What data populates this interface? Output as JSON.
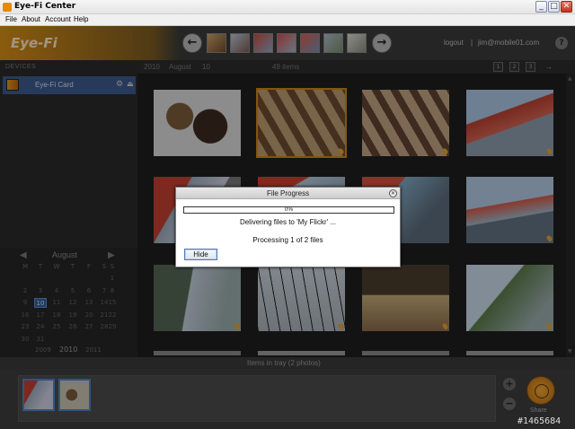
{
  "window": {
    "title": "Eye-Fi Center",
    "controls": {
      "minimize": "_",
      "maximize": "□",
      "close": "✕"
    }
  },
  "menu": [
    "File",
    "About",
    "Account",
    "Help"
  ],
  "header": {
    "logo": "Eye-Fi",
    "logout": "logout",
    "separator": "|",
    "user_email": "jim@mobile01.com",
    "help": "?"
  },
  "sidebar": {
    "devices_heading": "DEVICES",
    "device_label": "Eye-Fi Card"
  },
  "calendar": {
    "month": "August",
    "weekdays": [
      "M",
      "T",
      "W",
      "T",
      "F",
      "S",
      "S"
    ],
    "weeks": [
      [
        "",
        "",
        "",
        "",
        "",
        "",
        "1"
      ],
      [
        "2",
        "3",
        "4",
        "5",
        "6",
        "7",
        "8"
      ],
      [
        "9",
        "10",
        "11",
        "12",
        "13",
        "14",
        "15"
      ],
      [
        "16",
        "17",
        "18",
        "19",
        "20",
        "21",
        "22"
      ],
      [
        "23",
        "24",
        "25",
        "26",
        "27",
        "28",
        "29"
      ],
      [
        "30",
        "31",
        "",
        "",
        "",
        "",
        ""
      ]
    ],
    "selected_day": "10",
    "years": [
      "2009",
      "2010",
      "2011"
    ],
    "current_year": "2010"
  },
  "main": {
    "year": "2010",
    "month": "August",
    "day": "10",
    "item_count": "49 items",
    "view_buttons": [
      "1",
      "2",
      "3"
    ]
  },
  "dialog": {
    "title": "File Progress",
    "progress_percent": 0,
    "progress_label": "0%",
    "status": "Delivering files to 'My Flickr' ...",
    "processing": "Processing 1 of 2 files",
    "hide_label": "Hide"
  },
  "tray": {
    "label": "Items in tray (2 photos)",
    "add": "+",
    "remove": "−",
    "share_label": "Share"
  },
  "watermark": "#1465684",
  "colors": {
    "accent_orange": "#d58c16",
    "selection_blue": "#3d5a8c",
    "background": "#1e1e1e"
  }
}
